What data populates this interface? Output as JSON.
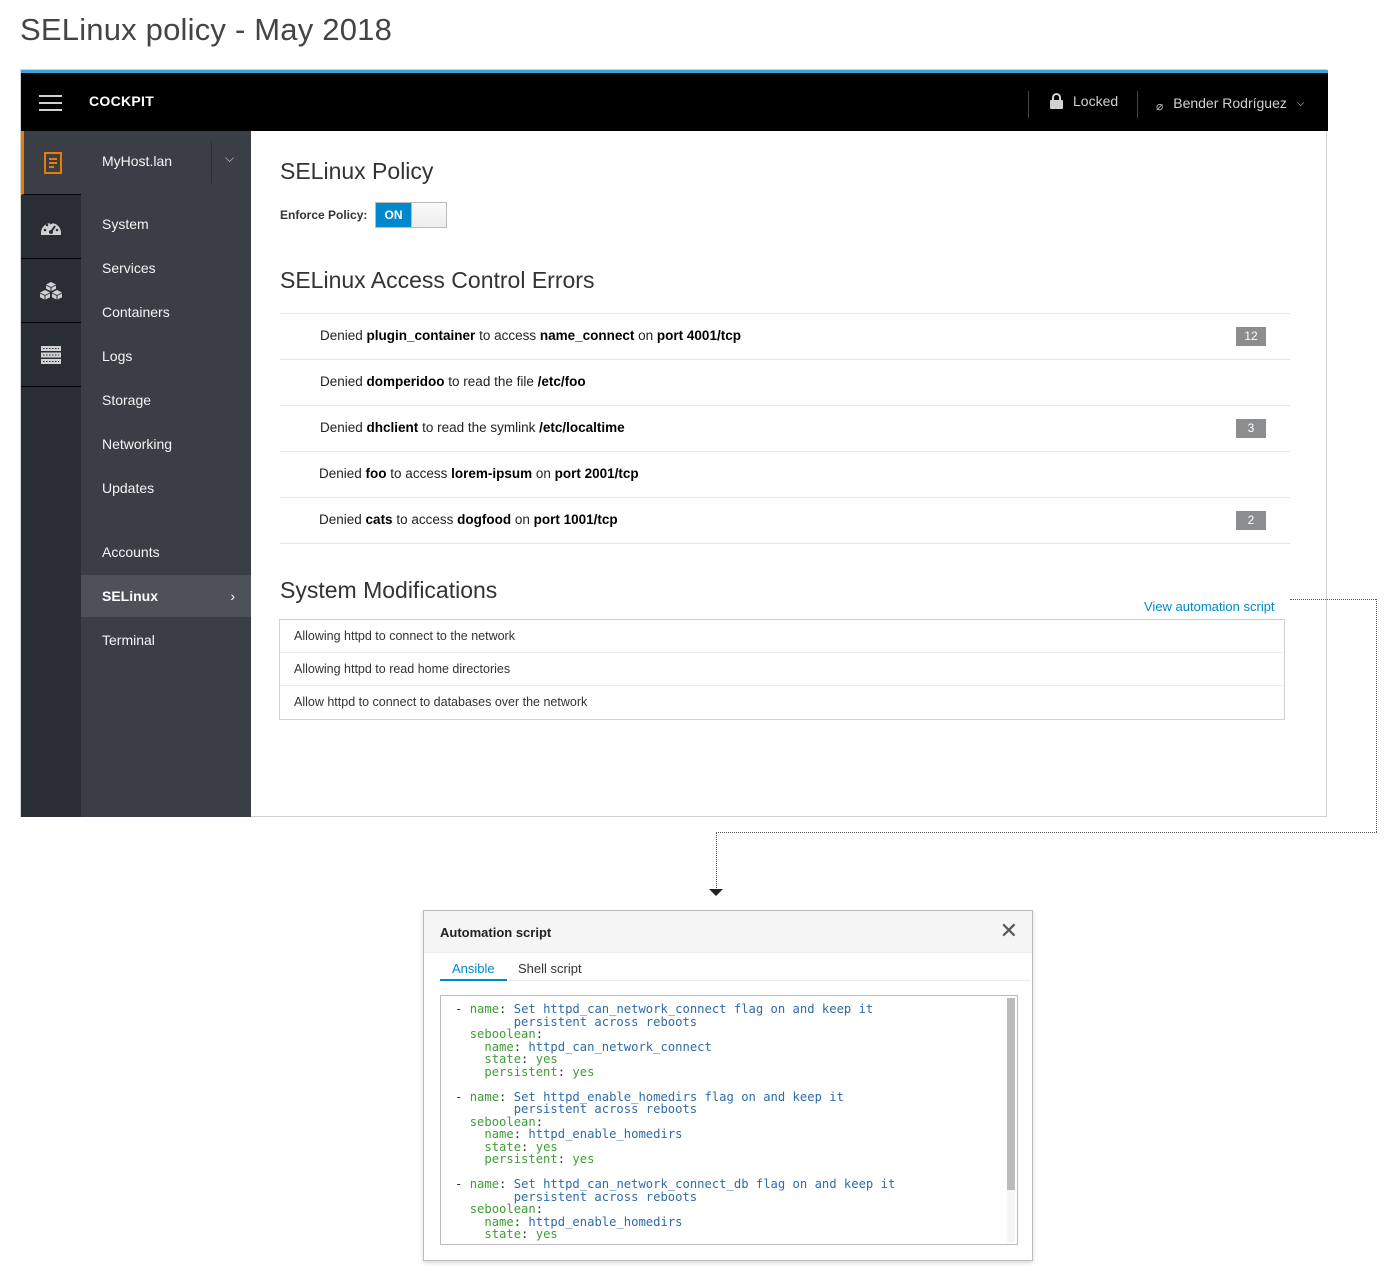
{
  "page": {
    "heading": "SELinux policy - May 2018"
  },
  "topbar": {
    "brand": "COCKPIT",
    "locked_label": "Locked",
    "user_name": "Bender Rodríguez",
    "accent_color": "#39a5dc"
  },
  "vertical_nav": {
    "items": [
      {
        "icon": "server-icon",
        "active": true
      },
      {
        "icon": "dashboard-icon",
        "active": false
      },
      {
        "icon": "cubes-icon",
        "active": false
      },
      {
        "icon": "storage-rack-icon",
        "active": false
      }
    ]
  },
  "sidebar": {
    "host": "MyHost.lan",
    "items": [
      {
        "label": "System"
      },
      {
        "label": "Services"
      },
      {
        "label": "Containers"
      },
      {
        "label": "Logs"
      },
      {
        "label": "Storage"
      },
      {
        "label": "Networking"
      },
      {
        "label": "Updates"
      },
      {
        "label": "Accounts"
      },
      {
        "label": "SELinux"
      },
      {
        "label": "Terminal"
      }
    ],
    "active": "SELinux"
  },
  "main": {
    "policy_title": "SELinux Policy",
    "enforce_label": "Enforce Policy:",
    "enforce_value": "ON",
    "errors_title": "SELinux Access Control Errors",
    "errors": [
      {
        "parts": [
          "Denied ",
          "plugin_container",
          " to access ",
          "name_connect",
          " on ",
          "port 4001/tcp"
        ],
        "count": "12"
      },
      {
        "parts": [
          "Denied ",
          "domperidoo",
          " to read the file ",
          "/etc/foo",
          "",
          ""
        ],
        "count": ""
      },
      {
        "parts": [
          "Denied ",
          "dhclient",
          " to read the symlink ",
          "/etc/localtime",
          "",
          ""
        ],
        "count": "3"
      },
      {
        "parts": [
          "Denied ",
          "foo",
          " to access ",
          "lorem-ipsum",
          " on ",
          "port 2001/tcp"
        ],
        "count": ""
      },
      {
        "parts": [
          "Denied ",
          "cats",
          " to access ",
          "dogfood",
          " on ",
          "port 1001/tcp"
        ],
        "count": "2"
      }
    ],
    "mods_title": "System Modifications",
    "view_script_link": "View automation script",
    "modifications": [
      "Allowing httpd to connect to the network",
      "Allowing httpd to read home directories",
      "Allow httpd to connect to databases over the network"
    ]
  },
  "modal": {
    "title": "Automation script",
    "tabs": [
      {
        "label": "Ansible",
        "active": true
      },
      {
        "label": "Shell script",
        "active": false
      }
    ],
    "tasks": [
      {
        "name_line1": "Set httpd_can_network_connect flag on and keep it",
        "name_line2": "persistent across reboots",
        "bool_name": "httpd_can_network_connect",
        "state": "yes",
        "persistent": "yes"
      },
      {
        "name_line1": "Set httpd_enable_homedirs flag on and keep it",
        "name_line2": "persistent across reboots",
        "bool_name": "httpd_enable_homedirs",
        "state": "yes",
        "persistent": "yes"
      },
      {
        "name_line1": "Set httpd_can_network_connect_db flag on and keep it",
        "name_line2": "persistent across reboots",
        "bool_name": "httpd_enable_homedirs",
        "state": "yes"
      }
    ],
    "keys": {
      "name": "name",
      "seboolean": "seboolean",
      "state": "state",
      "persistent": "persistent"
    }
  }
}
